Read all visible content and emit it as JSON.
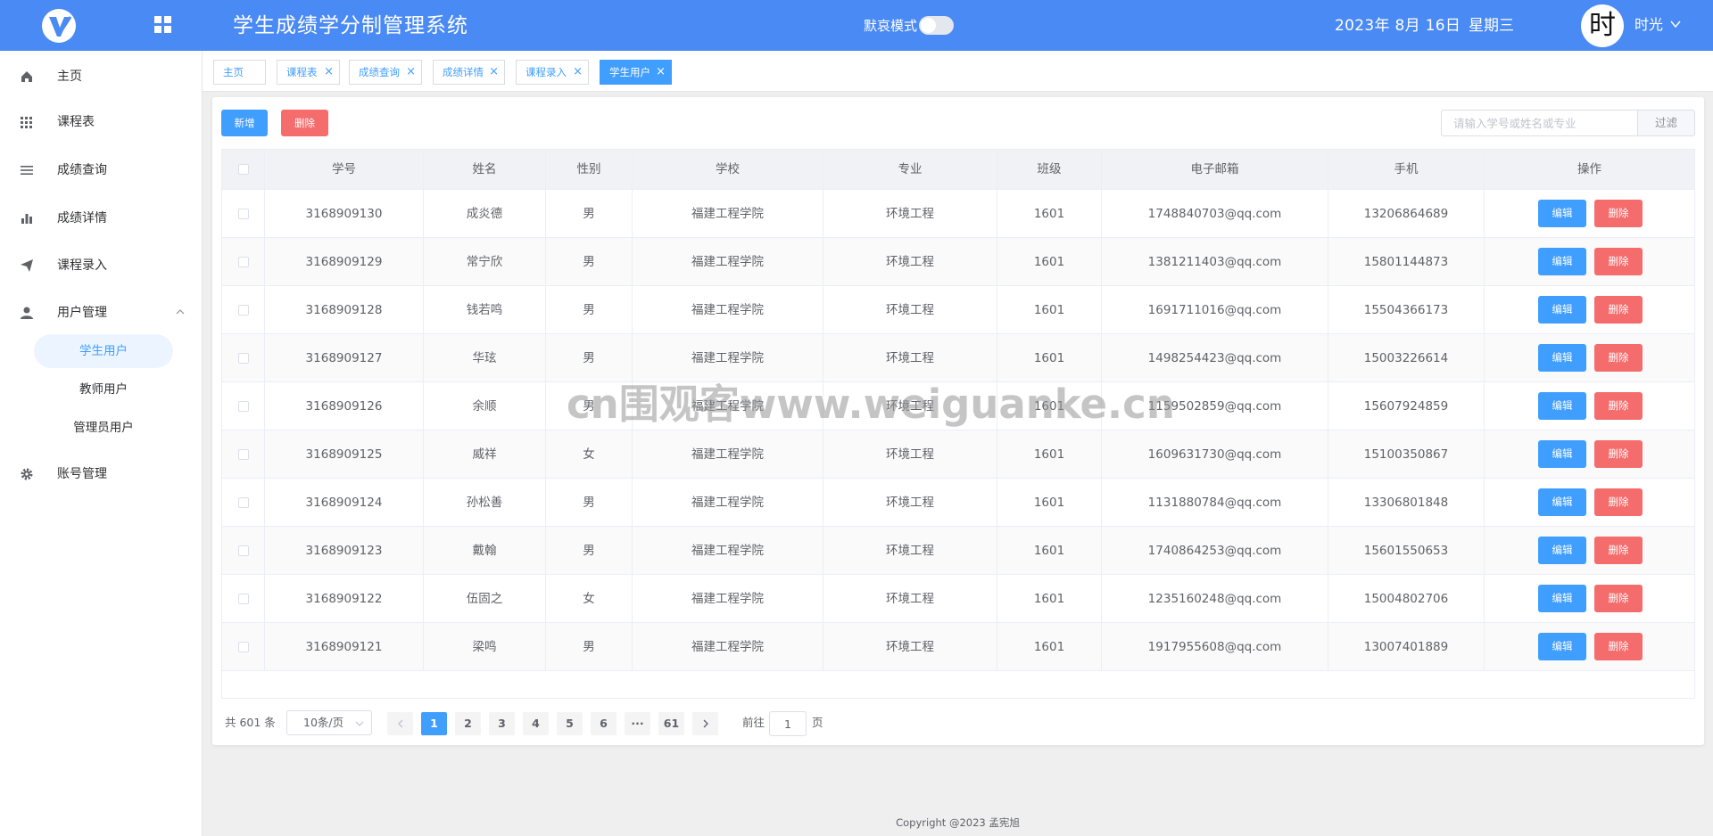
{
  "header": {
    "logo_icon": "v-logo-icon",
    "grid_icon": "grid-icon",
    "title": "学生成绩学分制管理系统",
    "mode_label": "默哀模式",
    "mode_on": false,
    "date": "2023年 8月 16日",
    "weekday": "星期三",
    "avatar_text": "时",
    "user_name": "时光",
    "accent_color": "#4a8af4"
  },
  "sidebar": {
    "items": [
      {
        "label": "主页",
        "icon": "home-icon"
      },
      {
        "label": "课程表",
        "icon": "grid-icon"
      },
      {
        "label": "成绩查询",
        "icon": "list-icon"
      },
      {
        "label": "成绩详情",
        "icon": "bar-chart-icon"
      },
      {
        "label": "课程录入",
        "icon": "send-icon"
      },
      {
        "label": "用户管理",
        "icon": "user-icon",
        "expanded": true
      },
      {
        "label": "账号管理",
        "icon": "gear-icon"
      }
    ],
    "sub_items": [
      {
        "label": "学生用户",
        "active": true
      },
      {
        "label": "教师用户"
      },
      {
        "label": "管理员用户"
      }
    ]
  },
  "tabs": [
    {
      "label": "主页"
    },
    {
      "label": "课程表"
    },
    {
      "label": "成绩查询"
    },
    {
      "label": "成绩详情"
    },
    {
      "label": "课程录入"
    },
    {
      "label": "学生用户",
      "active": true
    }
  ],
  "toolbar": {
    "add_label": "新增",
    "delete_label": "删除",
    "search_placeholder": "请输入学号或姓名或专业",
    "filter_label": "过滤"
  },
  "table": {
    "headers": [
      "学号",
      "姓名",
      "性别",
      "学校",
      "专业",
      "班级",
      "电子邮箱",
      "手机",
      "操作"
    ],
    "edit_label": "编辑",
    "delete_label": "删除",
    "rows": [
      {
        "id": "3168909130",
        "name": "成炎德",
        "gender": "男",
        "school": "福建工程学院",
        "major": "环境工程",
        "class": "1601",
        "email": "1748840703@qq.com",
        "phone": "13206864689"
      },
      {
        "id": "3168909129",
        "name": "常宁欣",
        "gender": "男",
        "school": "福建工程学院",
        "major": "环境工程",
        "class": "1601",
        "email": "1381211403@qq.com",
        "phone": "15801144873"
      },
      {
        "id": "3168909128",
        "name": "钱若鸣",
        "gender": "男",
        "school": "福建工程学院",
        "major": "环境工程",
        "class": "1601",
        "email": "1691711016@qq.com",
        "phone": "15504366173"
      },
      {
        "id": "3168909127",
        "name": "华玹",
        "gender": "男",
        "school": "福建工程学院",
        "major": "环境工程",
        "class": "1601",
        "email": "1498254423@qq.com",
        "phone": "15003226614"
      },
      {
        "id": "3168909126",
        "name": "余顺",
        "gender": "男",
        "school": "福建工程学院",
        "major": "环境工程",
        "class": "1601",
        "email": "1159502859@qq.com",
        "phone": "15607924859"
      },
      {
        "id": "3168909125",
        "name": "威祥",
        "gender": "女",
        "school": "福建工程学院",
        "major": "环境工程",
        "class": "1601",
        "email": "1609631730@qq.com",
        "phone": "15100350867"
      },
      {
        "id": "3168909124",
        "name": "孙松善",
        "gender": "男",
        "school": "福建工程学院",
        "major": "环境工程",
        "class": "1601",
        "email": "1131880784@qq.com",
        "phone": "13306801848"
      },
      {
        "id": "3168909123",
        "name": "戴翰",
        "gender": "男",
        "school": "福建工程学院",
        "major": "环境工程",
        "class": "1601",
        "email": "1740864253@qq.com",
        "phone": "15601550653"
      },
      {
        "id": "3168909122",
        "name": "伍固之",
        "gender": "女",
        "school": "福建工程学院",
        "major": "环境工程",
        "class": "1601",
        "email": "1235160248@qq.com",
        "phone": "15004802706"
      },
      {
        "id": "3168909121",
        "name": "梁鸣",
        "gender": "男",
        "school": "福建工程学院",
        "major": "环境工程",
        "class": "1601",
        "email": "1917955608@qq.com",
        "phone": "13007401889"
      }
    ]
  },
  "pagination": {
    "total_text": "共 601 条",
    "page_size": "10条/页",
    "pages": [
      "1",
      "2",
      "3",
      "4",
      "5",
      "6",
      "···",
      "61"
    ],
    "current_page": "1",
    "goto_label": "前往",
    "goto_value": "1",
    "page_suffix": "页"
  },
  "watermark": "cn围观客www.weiguanke.cn",
  "footer": "Copyright @2023 孟宪旭"
}
